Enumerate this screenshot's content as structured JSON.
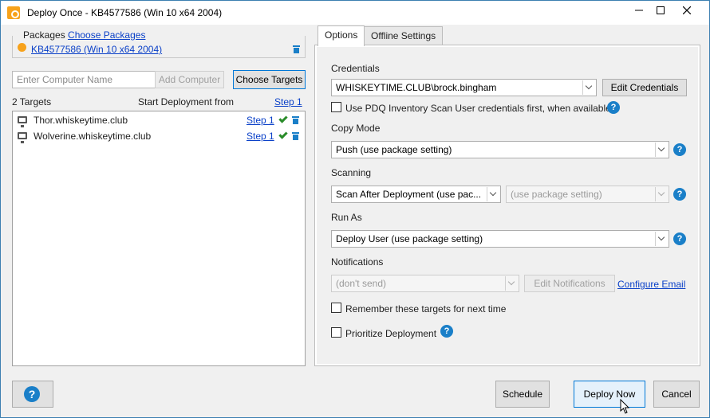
{
  "window": {
    "title": "Deploy Once - KB4577586 (Win 10 x64 2004)",
    "controls": [
      "minimize",
      "maximize",
      "close"
    ]
  },
  "packages": {
    "legend": "Packages",
    "choose_link": "Choose Packages",
    "item": "KB4577586 (Win 10 x64 2004)"
  },
  "targets": {
    "computer_placeholder": "Enter Computer Name",
    "add_computer_label": "Add Computer",
    "choose_targets_label": "Choose Targets",
    "count_label": "2 Targets",
    "start_from_label": "Start Deployment from",
    "start_step_link": "Step 1",
    "rows": [
      {
        "name": "Thor.whiskeytime.club",
        "step": "Step 1"
      },
      {
        "name": "Wolverine.whiskeytime.club",
        "step": "Step 1"
      }
    ]
  },
  "tabs": [
    {
      "label": "Options",
      "active": true
    },
    {
      "label": "Offline Settings",
      "active": false
    }
  ],
  "options": {
    "credentials_label": "Credentials",
    "credentials_value": "WHISKEYTIME.CLUB\\brock.bingham",
    "edit_credentials_label": "Edit Credentials",
    "use_pdq_label": "Use PDQ Inventory Scan User credentials first, when available",
    "copy_mode_label": "Copy Mode",
    "copy_mode_value": "Push (use package setting)",
    "scanning_label": "Scanning",
    "scanning_value": "Scan After Deployment (use pac...",
    "scanning_profile_value": "(use package setting)",
    "run_as_label": "Run As",
    "run_as_value": "Deploy User (use package setting)",
    "notifications_label": "Notifications",
    "notifications_value": "(don't send)",
    "edit_notifications_label": "Edit Notifications",
    "configure_email_link": "Configure Email",
    "remember_targets_label": "Remember these targets for next time",
    "prioritize_label": "Prioritize Deployment"
  },
  "footer": {
    "help_label": "?",
    "schedule_label": "Schedule",
    "deploy_now_label": "Deploy Now",
    "cancel_label": "Cancel"
  },
  "colors": {
    "accent": "#0078d7",
    "link": "#0a40c8",
    "icon_blue": "#1a7fc8",
    "check_green": "#2a8c2a",
    "package_orange": "#f7a21b"
  }
}
